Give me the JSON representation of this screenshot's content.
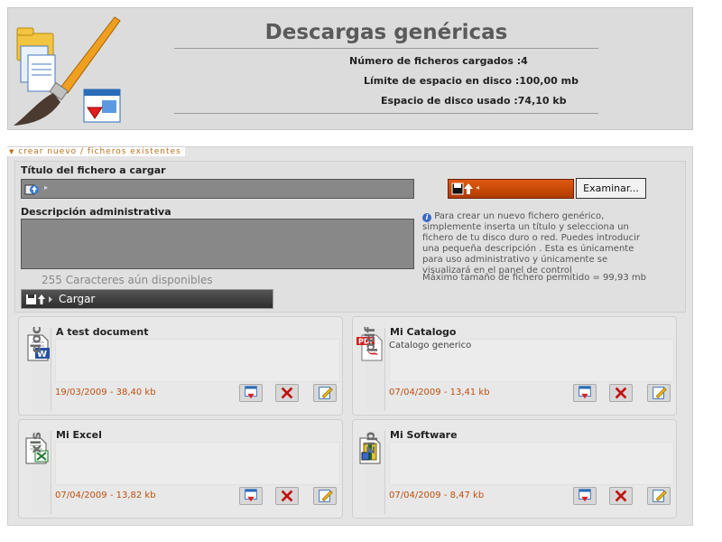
{
  "header": {
    "title": "Descargas genéricas",
    "stats": [
      {
        "label": "Número de ficheros cargados :",
        "value": "4"
      },
      {
        "label": "Límite de espacio en disco :",
        "value": "100,00 mb"
      },
      {
        "label": "Espacio de disco usado :",
        "value": "74,10 kb"
      }
    ]
  },
  "nav": {
    "breadcrumb": "crear nuevo / ficheros existentes"
  },
  "form": {
    "title_label": "Título del fichero a cargar",
    "title_value": "",
    "description_label": "Descripción administrativa",
    "description_value": "",
    "chars_remaining": "255 Caracteres aún disponibles",
    "browse_label": "Examinar...",
    "file_value": "",
    "info_text": "Para crear un nuevo fichero genérico, simplemente inserta un título y selecciona un fichero de tu disco duro o red. Puedes introducir una pequeña descripción . Esta es únicamente para uso administrativo y únicamente se visualizará en el panel de control",
    "max_size": "Máximo tamaño de fichero permitido = 99,93 mb",
    "upload_label": "Cargar"
  },
  "files": [
    {
      "name": "A test document",
      "ext": "doc",
      "description": "",
      "meta": "19/03/2009 - 38,40 kb",
      "icon": "word-document-icon"
    },
    {
      "name": "Mi Catalogo",
      "ext": "pdf",
      "description": "Catalogo generico",
      "meta": "07/04/2009 - 13,41 kb",
      "icon": "pdf-document-icon"
    },
    {
      "name": "Mi Excel",
      "ext": "xls",
      "description": "",
      "meta": "07/04/2009 - 13,82 kb",
      "icon": "excel-document-icon"
    },
    {
      "name": "Mi Software",
      "ext": "zip",
      "description": "",
      "meta": "07/04/2009 - 8,47 kb",
      "icon": "zip-archive-icon"
    }
  ],
  "colors": {
    "accent_orange": "#c05010",
    "title_gray": "#5a5a5a",
    "panel_bg": "#dcdcdc"
  }
}
